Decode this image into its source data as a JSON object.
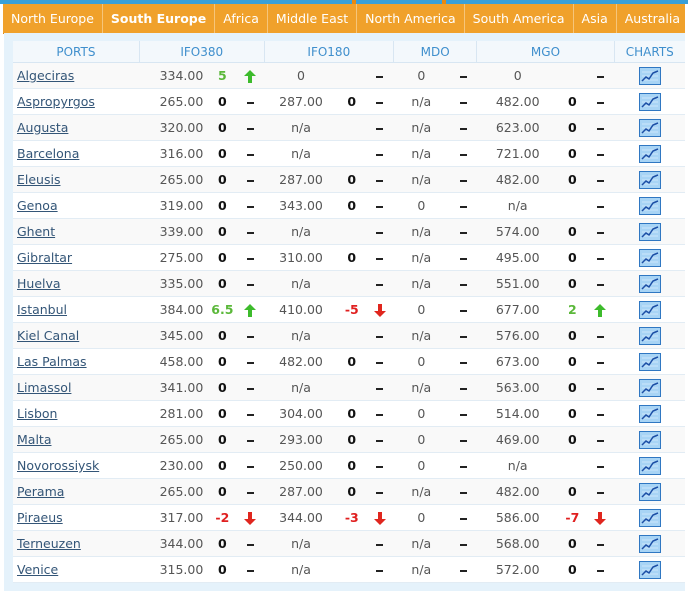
{
  "tabs": [
    {
      "label": "North Europe",
      "active": false
    },
    {
      "label": "South Europe",
      "active": true
    },
    {
      "label": "Africa",
      "active": false
    },
    {
      "label": "Middle East",
      "active": false
    },
    {
      "label": "North America",
      "active": false
    },
    {
      "label": "South America",
      "active": false
    },
    {
      "label": "Asia",
      "active": false
    },
    {
      "label": "Australia",
      "active": false
    }
  ],
  "headers": {
    "ports": "PORTS",
    "ifo380": "IFO380",
    "ifo180": "IFO180",
    "mdo": "MDO",
    "mgo": "MGO",
    "charts": "CHARTS"
  },
  "colors": {
    "tab_bar": "#f0a12b",
    "header_text": "#3f8fcd",
    "panel": "#e5f2fb",
    "up": "#5bb83a",
    "down": "#e02020"
  },
  "icons": {
    "up": "green-up-arrow-icon",
    "down": "red-down-arrow-icon",
    "unchanged": "dash-icon",
    "chart": "line-chart-icon"
  },
  "rows": [
    {
      "port": "Algeciras",
      "ifo380": "334.00",
      "ifo380_chg": "5",
      "ifo380_dir": "up",
      "ifo180": "0",
      "ifo180_chg": "",
      "ifo180_dir": "flat",
      "mdo": "0",
      "mdo_dir": "flat",
      "mgo": "0",
      "mgo_chg": "",
      "mgo_dir": "flat"
    },
    {
      "port": "Aspropyrgos",
      "ifo380": "265.00",
      "ifo380_chg": "0",
      "ifo380_dir": "flat",
      "ifo180": "287.00",
      "ifo180_chg": "0",
      "ifo180_dir": "flat",
      "mdo": "n/a",
      "mdo_dir": "flat",
      "mgo": "482.00",
      "mgo_chg": "0",
      "mgo_dir": "flat"
    },
    {
      "port": "Augusta",
      "ifo380": "320.00",
      "ifo380_chg": "0",
      "ifo380_dir": "flat",
      "ifo180": "n/a",
      "ifo180_chg": "",
      "ifo180_dir": "flat",
      "mdo": "n/a",
      "mdo_dir": "flat",
      "mgo": "623.00",
      "mgo_chg": "0",
      "mgo_dir": "flat"
    },
    {
      "port": "Barcelona",
      "ifo380": "316.00",
      "ifo380_chg": "0",
      "ifo380_dir": "flat",
      "ifo180": "n/a",
      "ifo180_chg": "",
      "ifo180_dir": "flat",
      "mdo": "n/a",
      "mdo_dir": "flat",
      "mgo": "721.00",
      "mgo_chg": "0",
      "mgo_dir": "flat"
    },
    {
      "port": "Eleusis",
      "ifo380": "265.00",
      "ifo380_chg": "0",
      "ifo380_dir": "flat",
      "ifo180": "287.00",
      "ifo180_chg": "0",
      "ifo180_dir": "flat",
      "mdo": "n/a",
      "mdo_dir": "flat",
      "mgo": "482.00",
      "mgo_chg": "0",
      "mgo_dir": "flat"
    },
    {
      "port": "Genoa",
      "ifo380": "319.00",
      "ifo380_chg": "0",
      "ifo380_dir": "flat",
      "ifo180": "343.00",
      "ifo180_chg": "0",
      "ifo180_dir": "flat",
      "mdo": "0",
      "mdo_dir": "flat",
      "mgo": "n/a",
      "mgo_chg": "",
      "mgo_dir": "flat"
    },
    {
      "port": "Ghent",
      "ifo380": "339.00",
      "ifo380_chg": "0",
      "ifo380_dir": "flat",
      "ifo180": "n/a",
      "ifo180_chg": "",
      "ifo180_dir": "flat",
      "mdo": "n/a",
      "mdo_dir": "flat",
      "mgo": "574.00",
      "mgo_chg": "0",
      "mgo_dir": "flat"
    },
    {
      "port": "Gibraltar",
      "ifo380": "275.00",
      "ifo380_chg": "0",
      "ifo380_dir": "flat",
      "ifo180": "310.00",
      "ifo180_chg": "0",
      "ifo180_dir": "flat",
      "mdo": "n/a",
      "mdo_dir": "flat",
      "mgo": "495.00",
      "mgo_chg": "0",
      "mgo_dir": "flat"
    },
    {
      "port": "Huelva",
      "ifo380": "335.00",
      "ifo380_chg": "0",
      "ifo380_dir": "flat",
      "ifo180": "n/a",
      "ifo180_chg": "",
      "ifo180_dir": "flat",
      "mdo": "n/a",
      "mdo_dir": "flat",
      "mgo": "551.00",
      "mgo_chg": "0",
      "mgo_dir": "flat"
    },
    {
      "port": "Istanbul",
      "ifo380": "384.00",
      "ifo380_chg": "6.5",
      "ifo380_dir": "up",
      "ifo180": "410.00",
      "ifo180_chg": "-5",
      "ifo180_dir": "down",
      "mdo": "0",
      "mdo_dir": "flat",
      "mgo": "677.00",
      "mgo_chg": "2",
      "mgo_dir": "up"
    },
    {
      "port": "Kiel Canal",
      "ifo380": "345.00",
      "ifo380_chg": "0",
      "ifo380_dir": "flat",
      "ifo180": "n/a",
      "ifo180_chg": "",
      "ifo180_dir": "flat",
      "mdo": "n/a",
      "mdo_dir": "flat",
      "mgo": "576.00",
      "mgo_chg": "0",
      "mgo_dir": "flat"
    },
    {
      "port": "Las Palmas",
      "ifo380": "458.00",
      "ifo380_chg": "0",
      "ifo380_dir": "flat",
      "ifo180": "482.00",
      "ifo180_chg": "0",
      "ifo180_dir": "flat",
      "mdo": "0",
      "mdo_dir": "flat",
      "mgo": "673.00",
      "mgo_chg": "0",
      "mgo_dir": "flat"
    },
    {
      "port": "Limassol",
      "ifo380": "341.00",
      "ifo380_chg": "0",
      "ifo380_dir": "flat",
      "ifo180": "n/a",
      "ifo180_chg": "",
      "ifo180_dir": "flat",
      "mdo": "n/a",
      "mdo_dir": "flat",
      "mgo": "563.00",
      "mgo_chg": "0",
      "mgo_dir": "flat"
    },
    {
      "port": "Lisbon",
      "ifo380": "281.00",
      "ifo380_chg": "0",
      "ifo380_dir": "flat",
      "ifo180": "304.00",
      "ifo180_chg": "0",
      "ifo180_dir": "flat",
      "mdo": "0",
      "mdo_dir": "flat",
      "mgo": "514.00",
      "mgo_chg": "0",
      "mgo_dir": "flat"
    },
    {
      "port": "Malta",
      "ifo380": "265.00",
      "ifo380_chg": "0",
      "ifo380_dir": "flat",
      "ifo180": "293.00",
      "ifo180_chg": "0",
      "ifo180_dir": "flat",
      "mdo": "0",
      "mdo_dir": "flat",
      "mgo": "469.00",
      "mgo_chg": "0",
      "mgo_dir": "flat"
    },
    {
      "port": "Novorossiysk",
      "ifo380": "230.00",
      "ifo380_chg": "0",
      "ifo380_dir": "flat",
      "ifo180": "250.00",
      "ifo180_chg": "0",
      "ifo180_dir": "flat",
      "mdo": "0",
      "mdo_dir": "flat",
      "mgo": "n/a",
      "mgo_chg": "",
      "mgo_dir": "flat"
    },
    {
      "port": "Perama",
      "ifo380": "265.00",
      "ifo380_chg": "0",
      "ifo380_dir": "flat",
      "ifo180": "287.00",
      "ifo180_chg": "0",
      "ifo180_dir": "flat",
      "mdo": "n/a",
      "mdo_dir": "flat",
      "mgo": "482.00",
      "mgo_chg": "0",
      "mgo_dir": "flat"
    },
    {
      "port": "Piraeus",
      "ifo380": "317.00",
      "ifo380_chg": "-2",
      "ifo380_dir": "down",
      "ifo180": "344.00",
      "ifo180_chg": "-3",
      "ifo180_dir": "down",
      "mdo": "0",
      "mdo_dir": "flat",
      "mgo": "586.00",
      "mgo_chg": "-7",
      "mgo_dir": "down"
    },
    {
      "port": "Terneuzen",
      "ifo380": "344.00",
      "ifo380_chg": "0",
      "ifo380_dir": "flat",
      "ifo180": "n/a",
      "ifo180_chg": "",
      "ifo180_dir": "flat",
      "mdo": "n/a",
      "mdo_dir": "flat",
      "mgo": "568.00",
      "mgo_chg": "0",
      "mgo_dir": "flat"
    },
    {
      "port": "Venice",
      "ifo380": "315.00",
      "ifo380_chg": "0",
      "ifo380_dir": "flat",
      "ifo180": "n/a",
      "ifo180_chg": "",
      "ifo180_dir": "flat",
      "mdo": "n/a",
      "mdo_dir": "flat",
      "mgo": "572.00",
      "mgo_chg": "0",
      "mgo_dir": "flat"
    }
  ]
}
